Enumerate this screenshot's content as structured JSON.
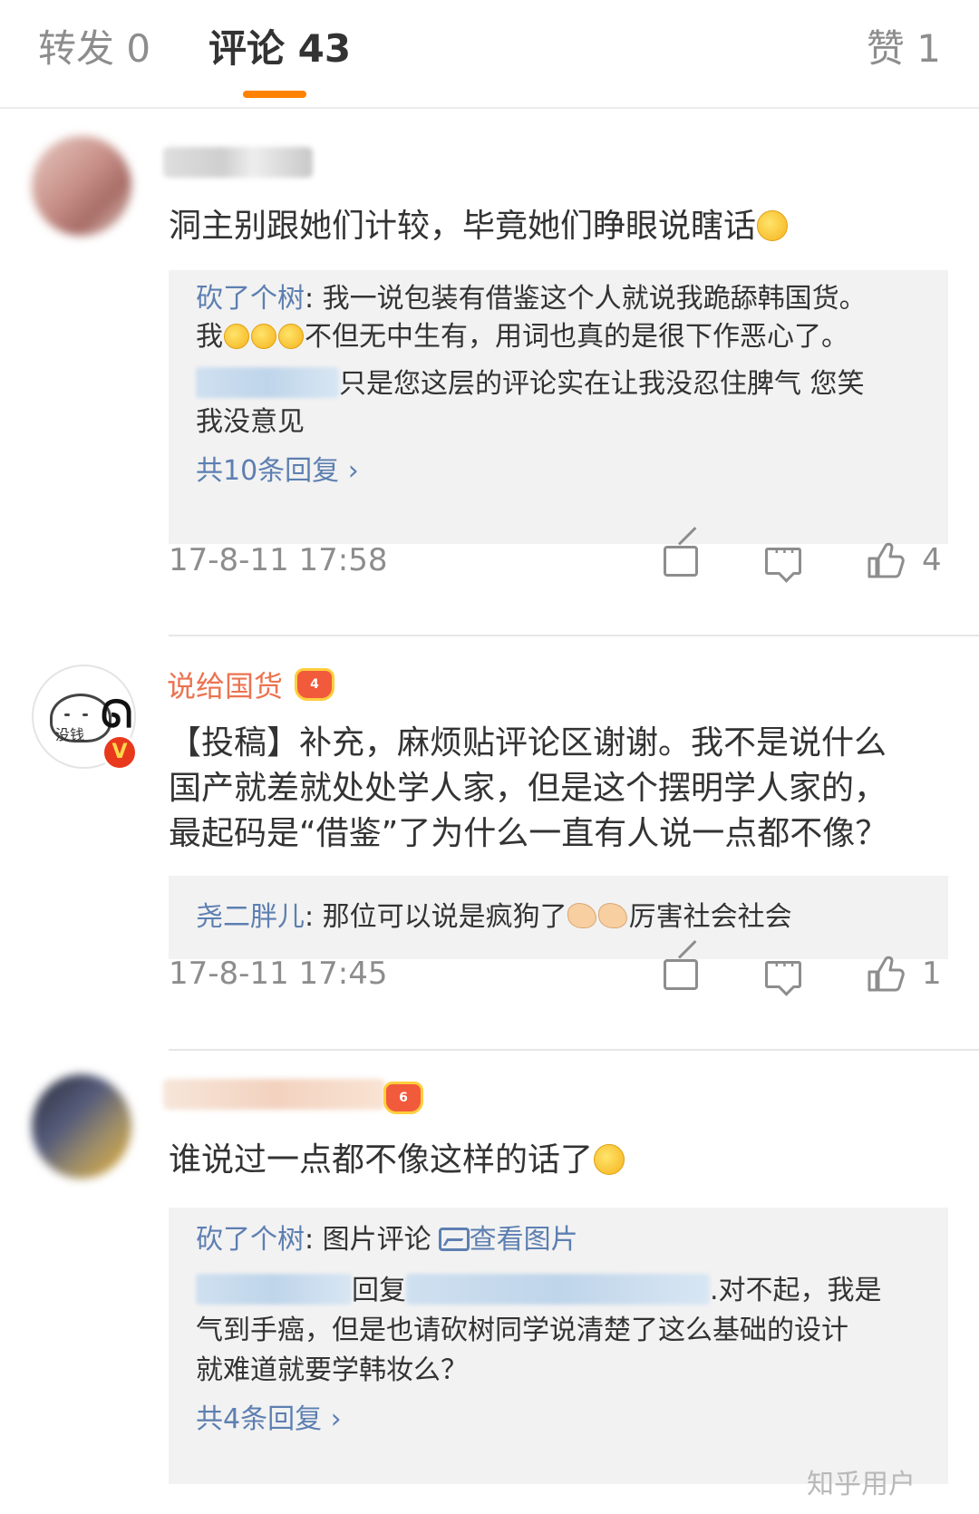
{
  "tabs": {
    "repost": "转发 0",
    "comments": "评论 43",
    "likes": "赞 1"
  },
  "comments": [
    {
      "text": "洞主别跟她们计较，毕竟她们睁眼说瞎话",
      "replies": [
        {
          "name": "砍了个树",
          "text": ": 我一说包装有借鉴这个人就说我跪舔韩国货。"
        },
        {
          "text_a": "我",
          "text_b": "不但无中生有，用词也真的是很下作恶心了。"
        },
        {
          "text": "只是您这层的评论实在让我没忍住脾气 您笑"
        },
        {
          "text": "我没意见"
        }
      ],
      "more_replies": "共10条回复 ›",
      "time": "17-8-11 17:58",
      "like_count": "4"
    },
    {
      "username": "说给国货",
      "avatar_text": "没钱",
      "badge_level": "4",
      "text_lines": [
        "【投稿】补充，麻烦贴评论区谢谢。我不是说什么",
        "国产就差就处处学人家，但是这个摆明学人家的，",
        "最起码是“借鉴”了为什么一直有人说一点都不像？"
      ],
      "reply": {
        "name": "尧二胖儿",
        "text_a": ": 那位可以说是疯狗了",
        "text_b": "厉害社会社会"
      },
      "time": "17-8-11 17:45",
      "like_count": "1"
    },
    {
      "badge_level": "6",
      "text": "谁说过一点都不像这样的话了",
      "replies": [
        {
          "name": "砍了个树",
          "text": ": 图片评论",
          "link": "查看图片"
        },
        {
          "text_a": "回复",
          "text_b": ".对不起，我是"
        },
        {
          "text": "气到手癌，但是也请砍树同学说清楚了这么基础的设计"
        },
        {
          "text": "就难道就要学韩妆么？"
        }
      ],
      "more_replies": "共4条回复 ›"
    }
  ],
  "watermark": "知乎用户",
  "colors": {
    "accent": "#ff8200",
    "username": "#eb7350",
    "link": "#5d7fb1",
    "muted": "#8d8d8d",
    "reply_bg": "#f2f2f2"
  },
  "icons": [
    "share-icon",
    "comment-icon",
    "like-icon",
    "chevron-right-icon",
    "image-icon",
    "vip-crown-icon",
    "verified-v-icon"
  ]
}
